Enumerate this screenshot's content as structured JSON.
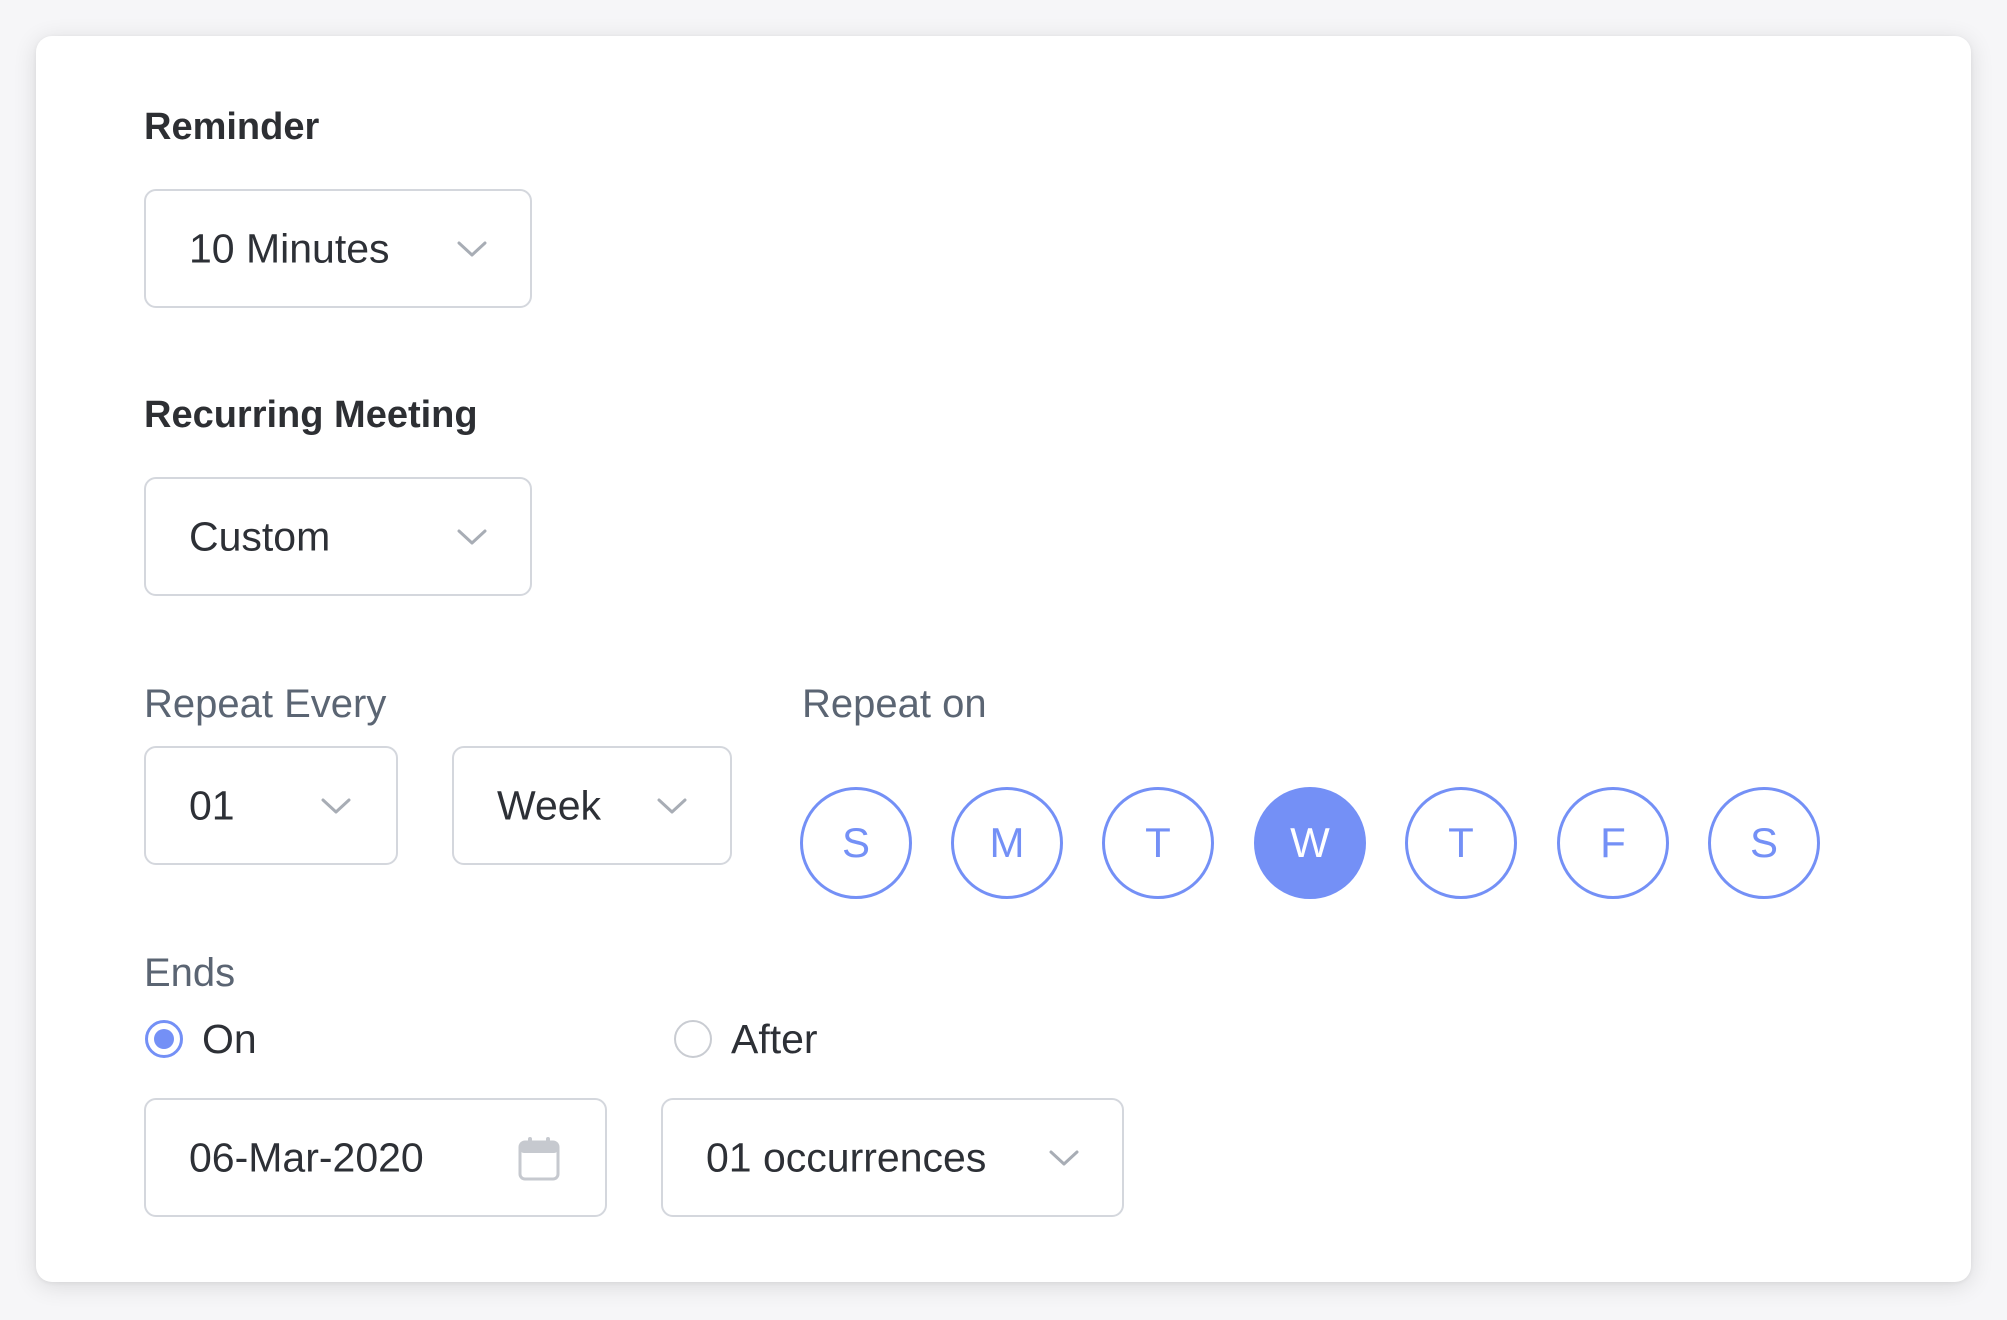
{
  "reminder": {
    "title": "Reminder",
    "value": "10 Minutes"
  },
  "recurring": {
    "title": "Recurring Meeting",
    "value": "Custom"
  },
  "repeat_every": {
    "label": "Repeat Every",
    "count": "01",
    "unit": "Week"
  },
  "repeat_on": {
    "label": "Repeat on",
    "days": [
      {
        "letter": "S",
        "selected": false
      },
      {
        "letter": "M",
        "selected": false
      },
      {
        "letter": "T",
        "selected": false
      },
      {
        "letter": "W",
        "selected": true
      },
      {
        "letter": "T",
        "selected": false
      },
      {
        "letter": "F",
        "selected": false
      },
      {
        "letter": "S",
        "selected": false
      }
    ]
  },
  "ends": {
    "label": "Ends",
    "option_on": {
      "label": "On",
      "checked": true
    },
    "option_after": {
      "label": "After",
      "checked": false
    },
    "date_value": "06-Mar-2020",
    "occurrences_value": "01 occurrences"
  },
  "colors": {
    "accent": "#7490f6",
    "border": "#d4d7dd",
    "title_text": "#2d2f33",
    "label_text": "#5b6573"
  },
  "icons": {
    "chevron": "chevron-down-icon",
    "calendar": "calendar-icon"
  }
}
